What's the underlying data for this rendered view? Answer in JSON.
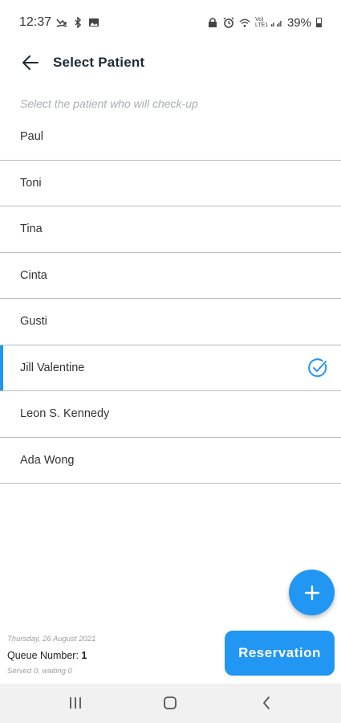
{
  "status_bar": {
    "time": "12:37",
    "battery": "39%",
    "network": "Vo) LTE1",
    "left_icons": [
      "missed-call-icon",
      "bluetooth-icon",
      "image-icon"
    ],
    "right_icons": [
      "lock-icon",
      "alarm-icon",
      "wifi-icon",
      "signal-icon",
      "battery-icon"
    ]
  },
  "header": {
    "title": "Select Patient",
    "back_icon": "arrow-left-icon"
  },
  "subtitle": "Select the patient who will check-up",
  "patients": [
    {
      "name": "Paul",
      "selected": false
    },
    {
      "name": "Toni",
      "selected": false
    },
    {
      "name": "Tina",
      "selected": false
    },
    {
      "name": "Cinta",
      "selected": false
    },
    {
      "name": "Gusti",
      "selected": false
    },
    {
      "name": "Jill Valentine",
      "selected": true
    },
    {
      "name": "Leon S. Kennedy",
      "selected": false
    },
    {
      "name": "Ada Wong",
      "selected": false
    }
  ],
  "fab": {
    "icon": "plus-icon"
  },
  "footer": {
    "date": "Thursday, 26 August 2021",
    "queue_label": "Queue Number:",
    "queue_number": "1",
    "served_text": "Served 0, waiting 0",
    "reservation_label": "Reservation"
  },
  "colors": {
    "accent": "#2196f3",
    "divider": "#b9bcbf",
    "nav_bg": "#f1f1f1"
  },
  "nav_bar": {
    "icons": [
      "recent-apps-icon",
      "home-icon",
      "back-nav-icon"
    ]
  }
}
